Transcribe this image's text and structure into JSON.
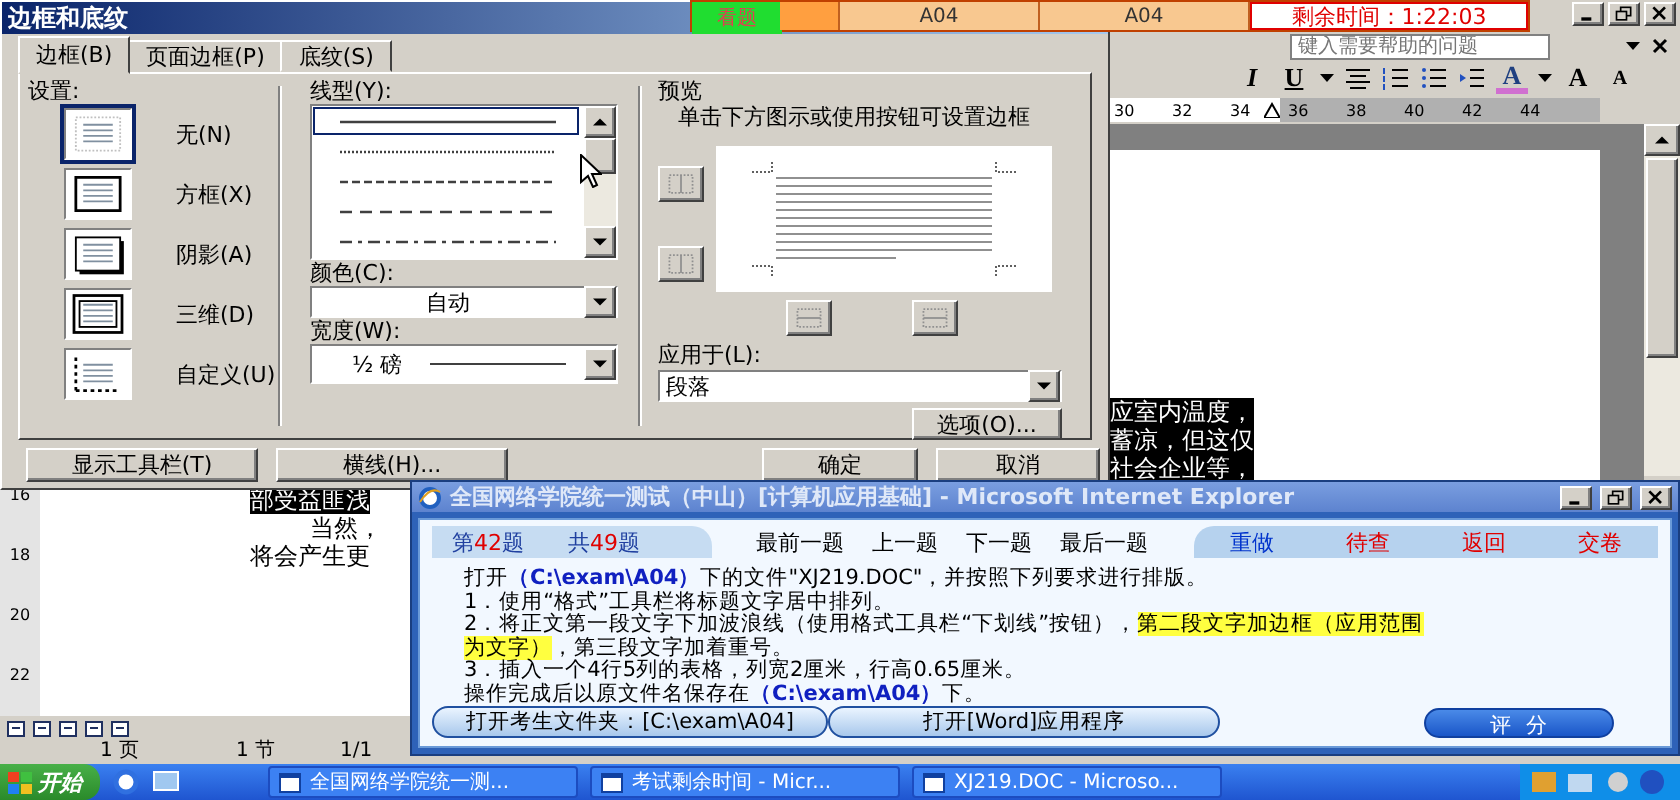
{
  "word": {
    "help_placeholder": "键入需要帮助的问题",
    "toolbar": [
      {
        "label": "I"
      },
      {
        "label": "U"
      },
      {
        "label": "A"
      },
      {
        "label": "A"
      },
      {
        "label": "A"
      }
    ],
    "ruler": [
      "30",
      "32",
      "34",
      "36",
      "38",
      "40",
      "42",
      "44"
    ],
    "vertical_ruler": [
      "16",
      "18",
      "20",
      "22"
    ],
    "document_right": [
      {
        "text": "应室内温度，",
        "highlighted": true
      },
      {
        "text": "蓄凉，但这仅",
        "highlighted": true
      },
      {
        "text": "社会企业等，",
        "highlighted": true
      }
    ],
    "document_left": [
      {
        "text": "部受益匪浅",
        "highlighted": true
      },
      {
        "text": "当然，",
        "highlighted": false
      },
      {
        "text": "将会产生更",
        "highlighted": false
      }
    ],
    "status_bar": [
      "1 页",
      "1 节",
      "1/1"
    ]
  },
  "exam_bar": {
    "cells": [
      {
        "label": "看题",
        "kind": "tab"
      },
      {
        "kind": "marker"
      },
      {
        "label": "A04",
        "kind": "field"
      },
      {
        "label": "A04",
        "kind": "field"
      }
    ],
    "timer": "剩余时间：1:22:03"
  },
  "dialog": {
    "title": "边框和底纹",
    "tabs": [
      {
        "label": "边框(B)",
        "selected": true
      },
      {
        "label": "页面边框(P)",
        "selected": false
      },
      {
        "label": "底纹(S)",
        "selected": false
      }
    ],
    "setting_label": "设置:",
    "settings": [
      {
        "label": "无(N)",
        "kind": "none",
        "selected": true
      },
      {
        "label": "方框(X)",
        "kind": "box",
        "selected": false
      },
      {
        "label": "阴影(A)",
        "kind": "shadow",
        "selected": false
      },
      {
        "label": "三维(D)",
        "kind": "raised",
        "selected": false
      },
      {
        "label": "自定义(U)",
        "kind": "custom",
        "selected": false
      }
    ],
    "line_style_label": "线型(Y):",
    "line_styles": [
      {
        "kind": "solid",
        "selected": true
      },
      {
        "kind": "dotted",
        "selected": false
      },
      {
        "kind": "dashed",
        "selected": false
      },
      {
        "kind": "long-dashed",
        "selected": false
      },
      {
        "kind": "dash-dot",
        "selected": false
      }
    ],
    "color_label": "颜色(C):",
    "color_value": "自动",
    "width_label": "宽度(W):",
    "width": "½ 磅",
    "preview_label": "预览",
    "preview_hint": "单击下方图示或使用按钮可设置边框",
    "apply_label": "应用于(L):",
    "apply_to": "段落",
    "options_button": "选项(O)...",
    "buttons": [
      {
        "label": "显示工具栏(T)"
      },
      {
        "label": "横线(H)..."
      },
      {
        "label": "确定"
      },
      {
        "label": "取消"
      }
    ]
  },
  "ie": {
    "title": "全国网络学院统一测试（中山）[计算机应用基础] - Microsoft Internet Explorer",
    "question_number": {
      "prefix": "第",
      "number": "42",
      "suffix": "题"
    },
    "question_total": {
      "prefix": "共",
      "number": "49",
      "suffix": "题"
    },
    "nav": [
      "最前一题",
      "上一题",
      "下一题",
      "最后一题"
    ],
    "actions": [
      {
        "label": "重做",
        "color": "#0033cc"
      },
      {
        "label": "待查",
        "color": "#e00000"
      },
      {
        "label": "返回",
        "color": "#e00000"
      },
      {
        "label": "交卷",
        "color": "#e00000"
      }
    ],
    "instructions": [
      "打开**（C:\\exam\\A04）**下的文件\"XJ219.DOC\"，并按照下列要求进行排版。",
      "1．使用“格式”工具栏将标题文字居中排列。",
      "2．将正文第一段文字下加波浪线（使用格式工具栏“下划线”按钮），*第二段文字加边框（应用范围*",
      "*为文字）*，第三段文字加着重号。",
      "3．插入一个4行5列的表格，列宽2厘米，行高0.65厘米。",
      "操作完成后以原文件名保存在**（C:\\exam\\A04）**下。"
    ],
    "buttons": [
      "打开考生文件夹：[C:\\exam\\A04]",
      "打开[Word]应用程序"
    ],
    "score_button": "评  分"
  },
  "taskbar": {
    "start": "开始",
    "tasks": [
      {
        "label": "全国网络学院统一测..."
      },
      {
        "label": "考试剩余时间 - Micr..."
      },
      {
        "label": "XJ219.DOC - Microso..."
      }
    ]
  }
}
